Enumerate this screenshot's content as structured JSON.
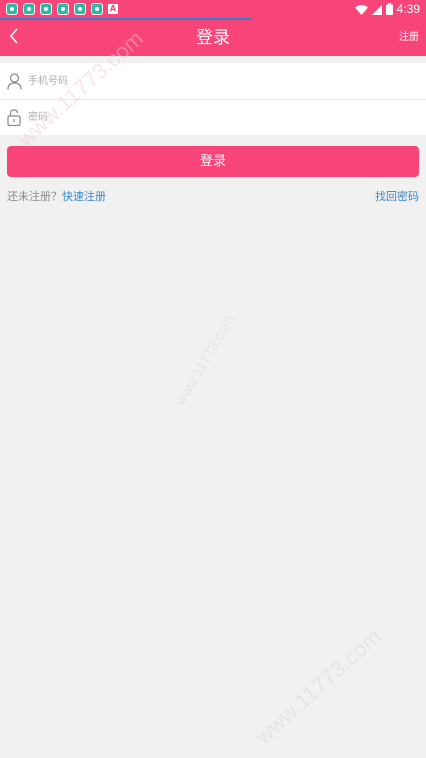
{
  "status_bar": {
    "time": "4:39",
    "notification_icons": [
      "app-icon",
      "app-icon",
      "app-icon",
      "app-icon",
      "app-icon",
      "app-icon",
      "a-icon"
    ],
    "notification_a_label": "A",
    "system_icons": [
      "wifi-icon",
      "signal-icon",
      "battery-icon"
    ]
  },
  "loading": {
    "progress": 0.59
  },
  "nav": {
    "title": "登录",
    "right_label": "注册",
    "back_icon": "chevron-left-icon"
  },
  "form": {
    "phone": {
      "placeholder": "手机号码",
      "value": "",
      "icon": "user-icon"
    },
    "password": {
      "placeholder": "密码",
      "value": "",
      "icon": "lock-icon"
    }
  },
  "login_button": {
    "label": "登录"
  },
  "links": {
    "no_account_hint": "还未注册？",
    "quick_register": "快速注册",
    "forgot_password": "找回密码"
  },
  "watermark": {
    "text": "www.11773.com"
  },
  "colors": {
    "accent": "#f7457a",
    "link": "#3a87c8",
    "progress": "#3d7bd1",
    "background": "#f1f1f2"
  }
}
